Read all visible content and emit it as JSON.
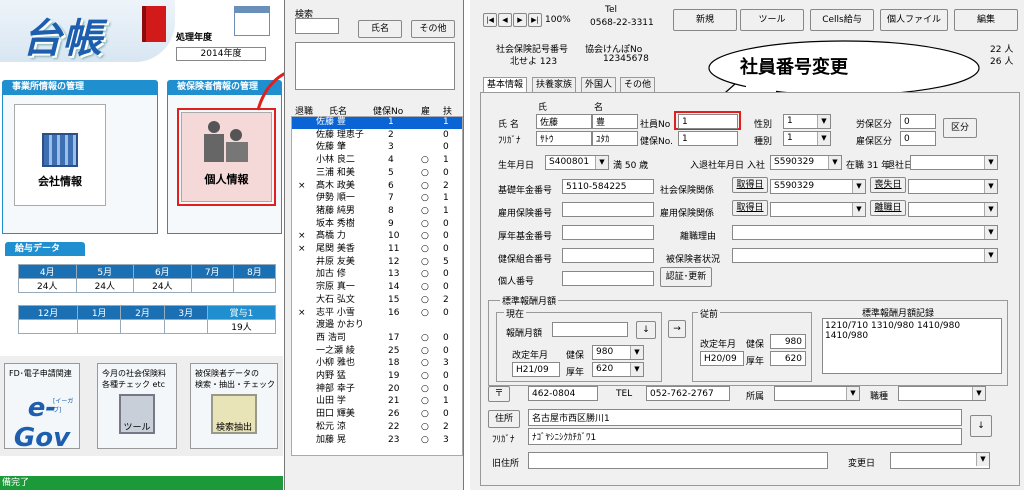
{
  "left": {
    "app_title": "台帳",
    "proc_year_label": "処理年度",
    "proc_year": "2014年度",
    "office_section": "事業所情報の管理",
    "insured_section": "被保険者情報の管理",
    "company_info": "会社情報",
    "personal_info": "個人情報",
    "salary_section": "給与データ",
    "months1": [
      "4月",
      "5月",
      "6月",
      "7月",
      "8月"
    ],
    "vals1": [
      "24人",
      "24人",
      "24人",
      "",
      ""
    ],
    "months2": [
      "12月",
      "1月",
      "2月",
      "3月",
      "賞与1"
    ],
    "vals2": [
      "",
      "",
      "",
      "",
      "19人"
    ],
    "tile1": "FD･電子申請関連",
    "tile2a": "今月の社会保険料",
    "tile2b": "各種チェック etc",
    "tile3a": "被保険者データの",
    "tile3b": "検索・抽出・チェック",
    "egov": "e-Gov",
    "egov_sub": "[イーガブ]",
    "tool_label": "ツール",
    "search_extract": "検索抽出",
    "status": "備完了"
  },
  "mid": {
    "search_label": "検索",
    "name_btn": "氏名",
    "other_btn": "その他",
    "headers": [
      "退職",
      "氏名",
      "健保No",
      "雇",
      "扶"
    ],
    "rows": [
      [
        "",
        "佐藤 豊",
        "1",
        "",
        "1"
      ],
      [
        "",
        "佐藤 理恵子",
        "2",
        "",
        "0"
      ],
      [
        "",
        "佐藤 肇",
        "3",
        "",
        "0"
      ],
      [
        "",
        "小林 良二",
        "4",
        "○",
        "1"
      ],
      [
        "",
        "三浦 和美",
        "5",
        "○",
        "0"
      ],
      [
        "×",
        "髙木 政美",
        "6",
        "○",
        "2"
      ],
      [
        "",
        "伊勢 順一",
        "7",
        "○",
        "1"
      ],
      [
        "",
        "猪藤 純男",
        "8",
        "○",
        "1"
      ],
      [
        "",
        "坂本 秀樹",
        "9",
        "○",
        "0"
      ],
      [
        "×",
        "髙橋 力",
        "10",
        "○",
        "0"
      ],
      [
        "×",
        "尾関 美香",
        "11",
        "○",
        "0"
      ],
      [
        "",
        "井原 友美",
        "12",
        "○",
        "5"
      ],
      [
        "",
        "加古 修",
        "13",
        "○",
        "0"
      ],
      [
        "",
        "宗原 真一",
        "14",
        "○",
        "0"
      ],
      [
        "",
        "大石 弘文",
        "15",
        "○",
        "2"
      ],
      [
        "×",
        "志平 小雪",
        "16",
        "○",
        "0"
      ],
      [
        "",
        "渡邉 かおり",
        "",
        "",
        ""
      ],
      [
        "",
        "西 浩司",
        "17",
        "○",
        "0"
      ],
      [
        "",
        "一之瀬 綾",
        "25",
        "○",
        "0"
      ],
      [
        "",
        "小柳 雅也",
        "18",
        "○",
        "3"
      ],
      [
        "",
        "内野 猛",
        "19",
        "○",
        "0"
      ],
      [
        "",
        "神部 幸子",
        "20",
        "○",
        "0"
      ],
      [
        "",
        "山田 学",
        "21",
        "○",
        "1"
      ],
      [
        "",
        "田口 輝美",
        "26",
        "○",
        "0"
      ],
      [
        "",
        "松元 涼",
        "22",
        "○",
        "2"
      ],
      [
        "",
        "加藤 晃",
        "23",
        "○",
        "3"
      ]
    ]
  },
  "right": {
    "nav": [
      "|◀",
      "◀",
      "▶",
      "▶|"
    ],
    "zoom": "100%",
    "tel_label": "Tel",
    "tel": "0568-22-3311",
    "btns": [
      "新規",
      "ツール",
      "Cells給与",
      "個人ファイル",
      "編集"
    ],
    "office_no_label": "社会保険記号番号",
    "office_no": "北せよ 123",
    "kyokai_label": "協会けんぽNo",
    "kyokai_no": "12345678",
    "count1": "22 人",
    "count2": "26 人",
    "balloon": "社員番号変更",
    "tabs": [
      "基本情報",
      "扶養家族",
      "外国人",
      "その他"
    ],
    "sei": "氏",
    "mei": "名",
    "name_label": "氏 名",
    "kana_label": "ﾌﾘｶﾞﾅ",
    "last": "佐藤",
    "first": "豊",
    "last_kana": "ｻﾄｳ",
    "first_kana": "ﾕﾀｶ",
    "empno_label": "社員No",
    "empno": "1",
    "kenpo_label": "健保No.",
    "kenpo": "1",
    "sex_label": "性別",
    "sex": "1",
    "kind_label": "種別",
    "kind": "1",
    "labor_label": "労保区分",
    "labor": "0",
    "emp_ins_label": "雇保区分",
    "emp_ins": "0",
    "kubun_btn": "区分",
    "birth_label": "生年月日",
    "birth": "S400801",
    "age": "満 50 歳",
    "join_label": "入退社年月日",
    "join_kana": "入社",
    "join": "S590329",
    "tenure": "在職 31 年",
    "leave_label": "退社日",
    "pension_label": "基礎年金番号",
    "pension": "5110-584225",
    "social_label": "社会保険関係",
    "acq1": "取得日",
    "social_date": "S590329",
    "loss1": "喪失日",
    "empins_no_label": "雇用保険番号",
    "empins_rel_label": "雇用保険関係",
    "acq2": "取得日",
    "leave2": "離職日",
    "kousei_label": "厚年基金番号",
    "reason_label": "離職理由",
    "kenkumi_label": "健保組合番号",
    "insured_status_label": "被保険者状況",
    "kojin_label": "個人番号",
    "auth_btn": "認証･更新",
    "std_title": "標準報酬月額",
    "current_label": "現在",
    "monthly_label": "報酬月額",
    "arrow_down": "↓",
    "arrow_right": "→",
    "rev_label": "改定年月",
    "kenpo_s": "健保",
    "kenpo_s_val": "980",
    "rev_val": "H21/09",
    "kosei_s": "厚年",
    "kosei_val": "620",
    "prev_label": "従前",
    "prev_rev_label": "改定年月",
    "prev_kenpo_label": "健保",
    "prev_kenpo": "980",
    "prev_rev": "H20/09",
    "prev_kosei_label": "厚年",
    "prev_kosei": "620",
    "record_title": "標準報酬月額記録",
    "record1": "1210/710  1310/980 1410/980",
    "record2": "1410/980",
    "zip_btn": "〒",
    "zip": "462-0804",
    "tel2_label": "TEL",
    "tel2": "052-762-2767",
    "dept_label": "所属",
    "post_label": "職種",
    "addr_btn": "住所",
    "addr": "名古屋市西区勝川1",
    "addr_kana_label": "ﾌﾘｶﾞﾅ",
    "addr_kana": "ﾅｺﾞﾔｼﾆｼｸｶﾁｶﾞﾜ1",
    "old_addr_label": "旧住所",
    "change_label": "変更日"
  },
  "colors": {
    "highlight_red": "#e0201c",
    "select_blue": "#0a64d6",
    "section_blue": "#1f8fcf"
  }
}
